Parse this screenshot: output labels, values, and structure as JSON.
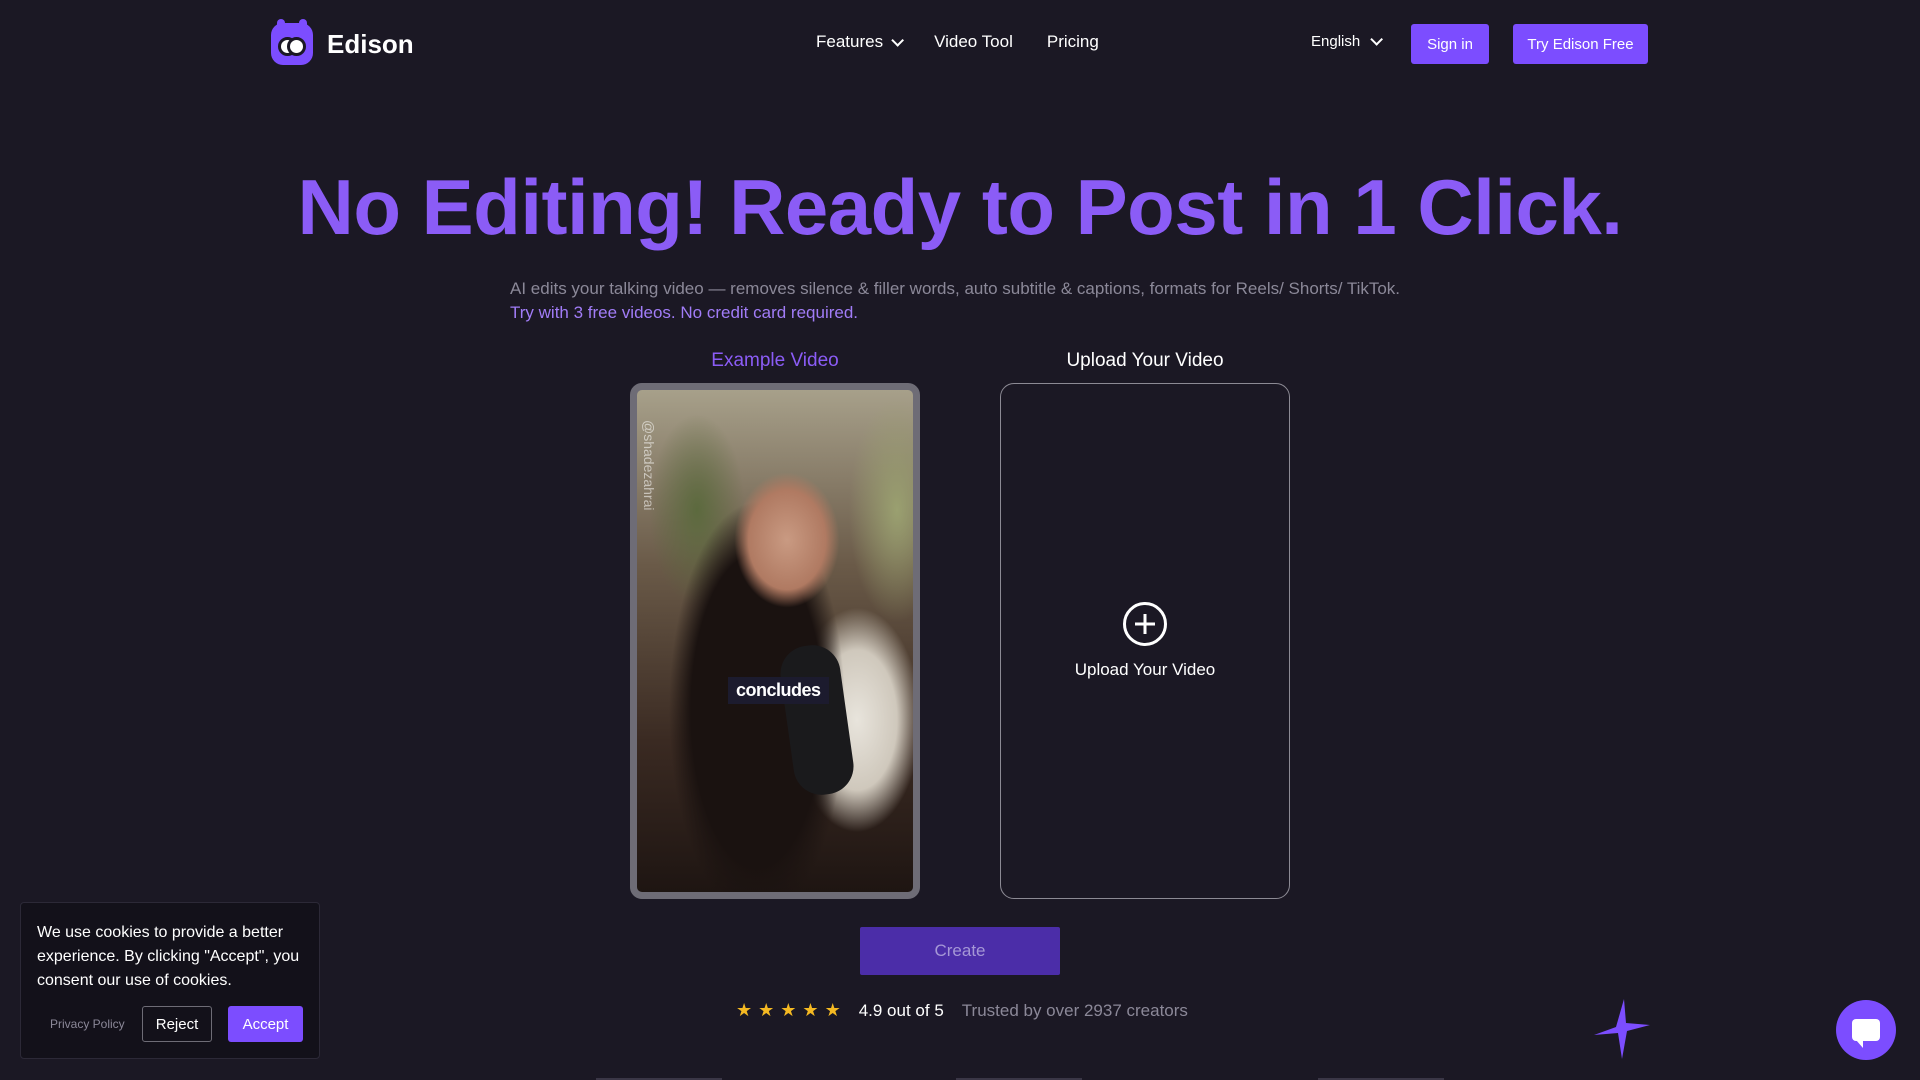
{
  "brand": {
    "name": "Edison",
    "logo_icon": "edison-robot-logo"
  },
  "nav": {
    "items": [
      {
        "label": "Features",
        "has_dropdown": true
      },
      {
        "label": "Video Tool",
        "has_dropdown": false
      },
      {
        "label": "Pricing",
        "has_dropdown": false
      }
    ]
  },
  "header": {
    "language": "English",
    "signin_label": "Sign in",
    "try_label": "Try Edison Free"
  },
  "hero": {
    "title": "No Editing! Ready to Post in 1 Click.",
    "subtitle": "AI edits your talking video — removes silence & filler words, auto subtitle & captions, formats for Reels/ Shorts/ TikTok.",
    "subtitle_note": "Try with 3 free videos. No credit card required."
  },
  "example": {
    "label": "Example Video",
    "watermark": "@shadezahrai",
    "caption": "concludes"
  },
  "upload": {
    "label": "Upload Your Video",
    "button_text": "Upload Your Video"
  },
  "create_label": "Create",
  "rating": {
    "stars": 5,
    "score_text": "4.9 out of 5",
    "trust_text": "Trusted by over 2937 creators"
  },
  "cookie": {
    "text": "We use cookies to provide a better experience. By clicking \"Accept\", you consent our use of cookies.",
    "privacy_label": "Privacy Policy",
    "reject_label": "Reject",
    "accept_label": "Accept"
  },
  "colors": {
    "accent": "#7c4dff",
    "title": "#8b5cf6",
    "background": "#1b1824",
    "star": "#f5b922"
  }
}
